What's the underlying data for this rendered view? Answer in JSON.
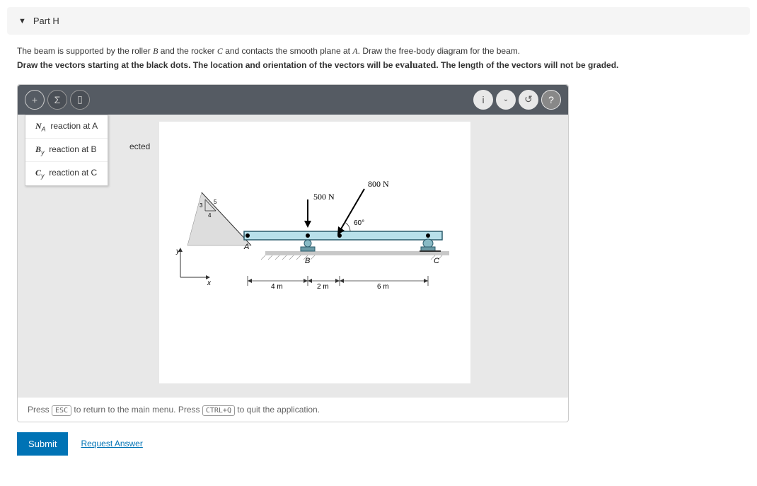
{
  "part": {
    "label": "Part H"
  },
  "problem": {
    "line1_pre": "The beam is supported by the roller ",
    "sym_B": "B",
    "line1_mid1": " and the rocker ",
    "sym_C": "C",
    "line1_mid2": " and contacts the smooth plane at ",
    "sym_A": "A",
    "line1_end": ". Draw the free-body diagram for the beam.",
    "line2_pre": "Draw the vectors starting at the black dots. The location and orientation of the vectors will be",
    "overlay": "evaluated",
    "line2_end": ". The length of the vectors will not be graded."
  },
  "dropdown": {
    "items": [
      {
        "sym": "N",
        "sub": "A",
        "text": "reaction at A"
      },
      {
        "sym": "B",
        "sub": "y",
        "text": "reaction at B"
      },
      {
        "sym": "C",
        "sub": "y",
        "text": "reaction at C"
      }
    ]
  },
  "ected": "ected",
  "diagram": {
    "force1": "500 N",
    "force2": "800 N",
    "angle": "60°",
    "ptA": "A",
    "ptB": "B",
    "ptC": "C",
    "dim1": "4 m",
    "dim2": "2 m",
    "dim3": "6 m",
    "axisX": "x",
    "axisY": "y",
    "lbl3": "3",
    "lbl4": "4",
    "lbl5": "5"
  },
  "footer": {
    "pre": "Press ",
    "key1": "ESC",
    "mid": " to return to the main menu. Press ",
    "key2": "CTRL+Q",
    "end": " to quit the application."
  },
  "actions": {
    "submit": "Submit",
    "request": "Request Answer"
  }
}
